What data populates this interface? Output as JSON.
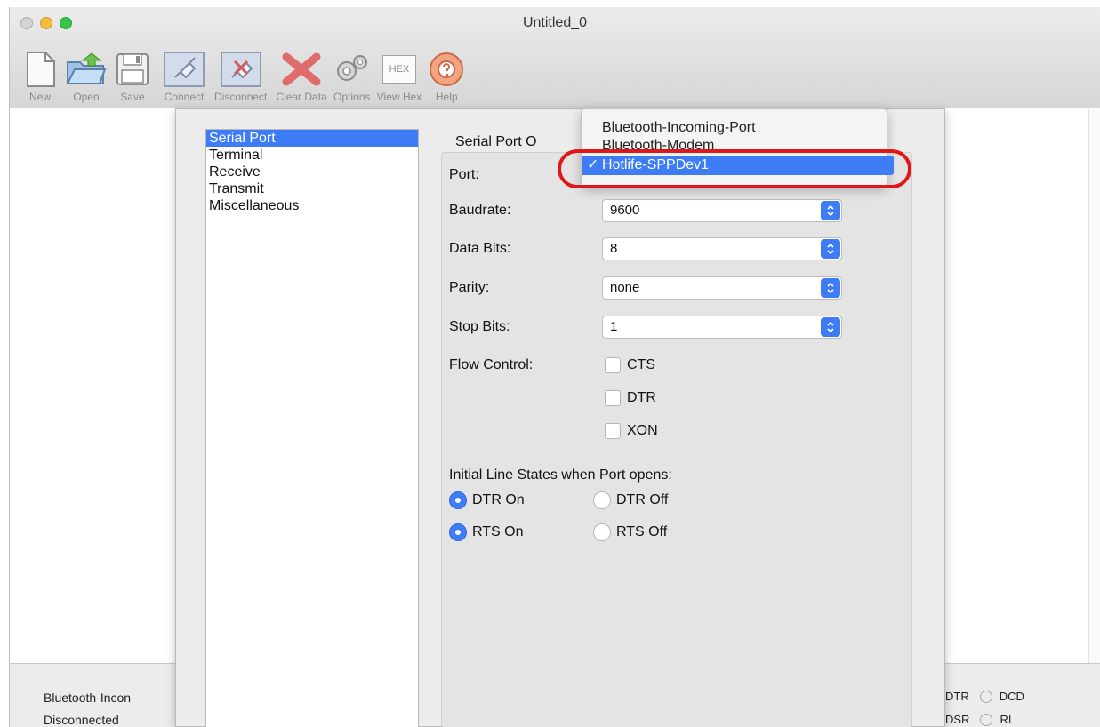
{
  "window": {
    "title": "Untitled_0"
  },
  "toolbar": {
    "new_label": "New",
    "open_label": "Open",
    "save_label": "Save",
    "connect_label": "Connect",
    "disconnect_label": "Disconnect",
    "clear_label": "Clear Data",
    "options_label": "Options",
    "viewhex_label": "View Hex",
    "viewhex_icon_text": "HEX",
    "help_label": "Help"
  },
  "sidebar": {
    "items": [
      {
        "label": "Serial Port"
      },
      {
        "label": "Terminal"
      },
      {
        "label": "Receive"
      },
      {
        "label": "Transmit"
      },
      {
        "label": "Miscellaneous"
      }
    ]
  },
  "serial": {
    "group_title": "Serial Port O",
    "port_label": "Port:",
    "baud_label": "Baudrate:",
    "baud_value": "9600",
    "databits_label": "Data Bits:",
    "databits_value": "8",
    "parity_label": "Parity:",
    "parity_value": "none",
    "stopbits_label": "Stop Bits:",
    "stopbits_value": "1",
    "flow_label": "Flow Control:",
    "flow": {
      "cts": "CTS",
      "dtr": "DTR",
      "xon": "XON"
    },
    "initial_label": "Initial Line States when Port opens:",
    "dtr_on": "DTR On",
    "dtr_off": "DTR Off",
    "rts_on": "RTS On",
    "rts_off": "RTS Off"
  },
  "popup": {
    "items": [
      {
        "label": "Bluetooth-Incoming-Port"
      },
      {
        "label": "Bluetooth-Modem"
      },
      {
        "label": "Hotlife-SPPDev1"
      }
    ],
    "check": "✓"
  },
  "status": {
    "port": "Bluetooth-Incon",
    "connection": "Disconnected",
    "led_dtr": "DTR",
    "led_dcd": "DCD",
    "led_dsr": "DSR",
    "led_ri": "RI"
  },
  "colors": {
    "accent": "#3d7cf5",
    "highlight_ring": "#e0161b"
  }
}
